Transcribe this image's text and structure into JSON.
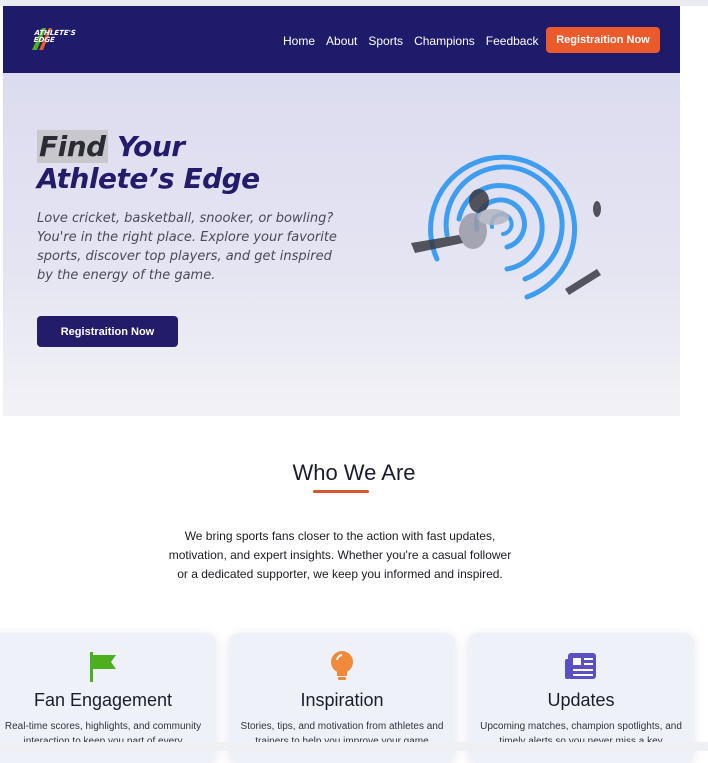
{
  "brand": {
    "logo_text": "ATHLETE'S EDGE"
  },
  "nav": {
    "links": [
      "Home",
      "About",
      "Sports",
      "Champions",
      "Feedback"
    ],
    "cta_label": "Registraition Now"
  },
  "hero": {
    "title_highlight": "Find",
    "title_rest_line1": " Your",
    "title_line2": "Athlete’s Edge",
    "text": "Love cricket, basketball, snooker, or bowling? You're in the right place. Explore your favorite sports, discover top players, and get inspired by the energy of the game.",
    "cta_label": "Registraition Now"
  },
  "who": {
    "title": "Who We Are",
    "text": "We bring sports fans closer to the action with fast updates, motivation, and expert insights. Whether you're a casual follower or a dedicated supporter, we keep you informed and inspired."
  },
  "cards": [
    {
      "icon": "flag-icon",
      "color": "#4caf1f",
      "title": "Fan Engagement",
      "text": "Real-time scores, highlights, and community interaction to keep you part of every"
    },
    {
      "icon": "lightbulb-icon",
      "color": "#f08a3a",
      "title": "Inspiration",
      "text": "Stories, tips, and motivation from athletes and trainers to help you improve your game"
    },
    {
      "icon": "newspaper-icon",
      "color": "#5b4fc4",
      "title": "Updates",
      "text": "Upcoming matches, champion spotlights, and timely alerts so you never miss a key"
    }
  ],
  "colors": {
    "navy": "#1f1b6b",
    "accent": "#ea5a2a",
    "graphic_blue": "#3d9df0"
  }
}
